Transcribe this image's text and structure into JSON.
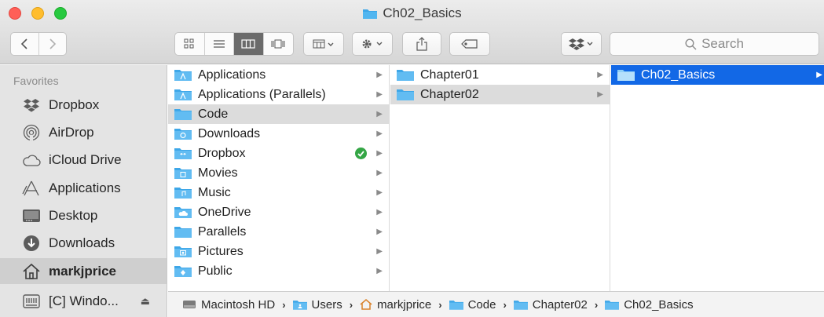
{
  "window": {
    "title": "Ch02_Basics"
  },
  "toolbar": {
    "search_placeholder": "Search"
  },
  "sidebar": {
    "heading": "Favorites",
    "items": [
      {
        "label": "Dropbox",
        "icon": "dropbox-icon"
      },
      {
        "label": "AirDrop",
        "icon": "airdrop-icon"
      },
      {
        "label": "iCloud Drive",
        "icon": "cloud-icon"
      },
      {
        "label": "Applications",
        "icon": "applications-icon"
      },
      {
        "label": "Desktop",
        "icon": "desktop-icon"
      },
      {
        "label": "Downloads",
        "icon": "downloads-icon"
      },
      {
        "label": "markjprice",
        "icon": "home-icon",
        "selected": true
      },
      {
        "label": "[C] Windo...",
        "icon": "disk-icon"
      }
    ]
  },
  "columns": [
    {
      "items": [
        {
          "label": "Applications"
        },
        {
          "label": "Applications (Parallels)"
        },
        {
          "label": "Code",
          "selected": "gray"
        },
        {
          "label": "Downloads"
        },
        {
          "label": "Dropbox",
          "synced": true
        },
        {
          "label": "Movies"
        },
        {
          "label": "Music"
        },
        {
          "label": "OneDrive"
        },
        {
          "label": "Parallels"
        },
        {
          "label": "Pictures"
        },
        {
          "label": "Public"
        }
      ]
    },
    {
      "items": [
        {
          "label": "Chapter01"
        },
        {
          "label": "Chapter02",
          "selected": "gray"
        }
      ]
    },
    {
      "items": [
        {
          "label": "Ch02_Basics",
          "selected": "blue"
        }
      ]
    }
  ],
  "pathbar": {
    "crumbs": [
      "Macintosh HD",
      "Users",
      "markjprice",
      "Code",
      "Chapter02",
      "Ch02_Basics"
    ],
    "separator": "›"
  },
  "colors": {
    "selection_blue": "#1268e6",
    "folder_blue": "#3ea7e8"
  }
}
